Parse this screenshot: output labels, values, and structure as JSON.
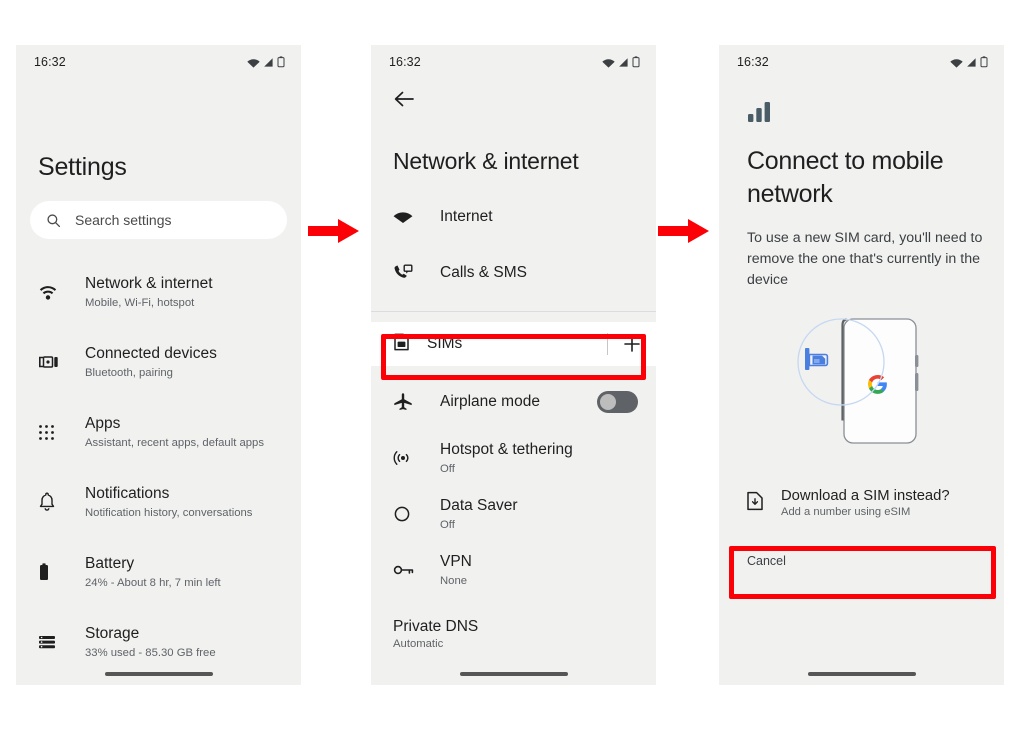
{
  "meta": {
    "accent_red": "#fb0007",
    "screen_bg": "#f1f1f0",
    "text_primary": "#1f1f1f",
    "text_secondary": "#5f6368"
  },
  "statusbar": {
    "clock": "16:32",
    "icons": [
      "wifi-icon",
      "cell-signal-icon",
      "battery-icon"
    ]
  },
  "arrows": [
    {
      "name": "step-arrow-1"
    },
    {
      "name": "step-arrow-2"
    }
  ],
  "screen1": {
    "title": "Settings",
    "search": {
      "placeholder": "Search settings",
      "value": "Search settings",
      "icon": "search-icon"
    },
    "items": [
      {
        "icon": "wifi-icon",
        "title": "Network & internet",
        "subtitle": "Mobile, Wi-Fi, hotspot"
      },
      {
        "icon": "connected-devices-icon",
        "title": "Connected devices",
        "subtitle": "Bluetooth, pairing"
      },
      {
        "icon": "apps-grid-icon",
        "title": "Apps",
        "subtitle": "Assistant, recent apps, default apps"
      },
      {
        "icon": "bell-icon",
        "title": "Notifications",
        "subtitle": "Notification history, conversations"
      },
      {
        "icon": "battery-icon",
        "title": "Battery",
        "subtitle": "24% - About 8 hr, 7 min left"
      },
      {
        "icon": "storage-icon",
        "title": "Storage",
        "subtitle": "33% used - 85.30 GB free"
      }
    ]
  },
  "screen2": {
    "back_icon": "back-arrow-icon",
    "title": "Network & internet",
    "items_top": [
      {
        "icon": "wifi-solid-icon",
        "title": "Internet",
        "subtitle": ""
      },
      {
        "icon": "calls-sms-icon",
        "title": "Calls & SMS",
        "subtitle": ""
      }
    ],
    "sims_row": {
      "icon": "sim-card-icon",
      "title": "SIMs",
      "add_icon": "plus-icon",
      "highlighted": true
    },
    "items_bottom": [
      {
        "icon": "airplane-icon",
        "title": "Airplane mode",
        "subtitle": "",
        "toggle": "off"
      },
      {
        "icon": "hotspot-icon",
        "title": "Hotspot & tethering",
        "subtitle": "Off"
      },
      {
        "icon": "data-saver-icon",
        "title": "Data Saver",
        "subtitle": "Off"
      },
      {
        "icon": "vpn-key-icon",
        "title": "VPN",
        "subtitle": "None"
      }
    ],
    "private_dns": {
      "title": "Private DNS",
      "subtitle": "Automatic"
    }
  },
  "screen3": {
    "header_icon": "signal-bars-icon",
    "title": "Connect to mobile network",
    "body": "To use a new SIM card, you'll need to remove the one that's currently in the device",
    "illustration": "sim-tray-phone-illustration",
    "esim_row": {
      "icon": "esim-download-icon",
      "title": "Download a SIM instead?",
      "subtitle": "Add a number using eSIM",
      "highlighted": true
    },
    "cancel_label": "Cancel"
  }
}
